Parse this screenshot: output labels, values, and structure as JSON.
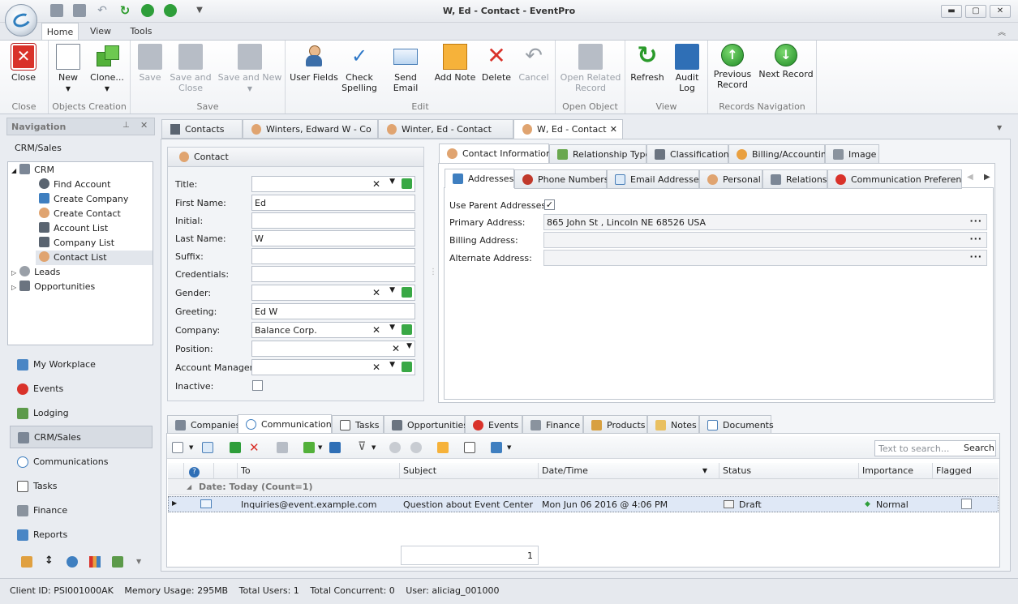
{
  "window": {
    "title": "W, Ed - Contact - EventPro",
    "minimize": "▬",
    "restore": "▢",
    "close": "✕"
  },
  "ribbon_tabs": [
    "Home",
    "View",
    "Tools"
  ],
  "ribbon": {
    "groups": [
      "Close",
      "Objects Creation",
      "Save",
      "Edit",
      "Open Object",
      "View",
      "Records Navigation"
    ],
    "buttons": {
      "close": "Close",
      "new": "New",
      "clone": "Clone...",
      "save": "Save",
      "save_close_1": "Save and",
      "save_close_2": "Close",
      "save_new": "Save and New",
      "user_fields": "User Fields",
      "check_1": "Check",
      "check_2": "Spelling",
      "send_email": "Send Email",
      "add_note": "Add Note",
      "delete": "Delete",
      "cancel": "Cancel",
      "open_related_1": "Open Related",
      "open_related_2": "Record",
      "refresh": "Refresh",
      "audit_1": "Audit",
      "audit_2": "Log",
      "prev_1": "Previous",
      "prev_2": "Record",
      "next": "Next Record"
    }
  },
  "navigation": {
    "title": "Navigation",
    "section": "CRM/Sales",
    "tree": {
      "crm": "CRM",
      "items": [
        "Find Account",
        "Create Company",
        "Create Contact",
        "Account List",
        "Company List",
        "Contact List"
      ],
      "leads": "Leads",
      "opportunities": "Opportunities"
    },
    "buttons": [
      "My Workplace",
      "Events",
      "Lodging",
      "CRM/Sales",
      "Communications",
      "Tasks",
      "Finance",
      "Reports"
    ]
  },
  "doc_tabs": [
    "Contacts",
    "Winters, Edward W - Co",
    "Winter, Ed - Contact",
    "W, Ed - Contact"
  ],
  "contact": {
    "header": "Contact",
    "fields": {
      "title": {
        "label": "Title:",
        "value": ""
      },
      "first_name": {
        "label": "First Name:",
        "value": "Ed"
      },
      "initial": {
        "label": "Initial:",
        "value": ""
      },
      "last_name": {
        "label": "Last Name:",
        "value": "W"
      },
      "suffix": {
        "label": "Suffix:",
        "value": ""
      },
      "credentials": {
        "label": "Credentials:",
        "value": ""
      },
      "gender": {
        "label": "Gender:",
        "value": ""
      },
      "greeting": {
        "label": "Greeting:",
        "value": "Ed W"
      },
      "company": {
        "label": "Company:",
        "value": "Balance Corp."
      },
      "position": {
        "label": "Position:",
        "value": ""
      },
      "account_manager": {
        "label": "Account Manager:",
        "value": ""
      },
      "inactive": {
        "label": "Inactive:"
      }
    }
  },
  "info_tabs": [
    "Contact Information",
    "Relationship Type",
    "Classification",
    "Billing/Accounting",
    "Image"
  ],
  "sub_tabs": [
    "Addresses",
    "Phone Numbers",
    "Email Addresses",
    "Personal",
    "Relations",
    "Communication Preferences"
  ],
  "addresses": {
    "use_parent": "Use Parent Addresses:",
    "primary_label": "Primary Address:",
    "primary_value": "865 John St , Lincoln NE 68526 USA",
    "billing_label": "Billing Address:",
    "billing_value": "",
    "alternate_label": "Alternate Address:",
    "alternate_value": ""
  },
  "bottom_tabs": [
    "Companies",
    "Communications",
    "Tasks",
    "Opportunities",
    "Events",
    "Finance",
    "Products",
    "Notes",
    "Documents"
  ],
  "grid": {
    "search_placeholder": "Text to search...",
    "search_button": "Search",
    "columns": [
      "To",
      "Subject",
      "Date/Time",
      "Status",
      "Importance",
      "Flagged"
    ],
    "group": "Date: Today (Count=1)",
    "rows": [
      {
        "to": "Inquiries@event.example.com",
        "subject": "Question about Event Center",
        "datetime": "Mon Jun 06 2016 @ 4:06 PM",
        "status": "Draft",
        "importance": "Normal"
      }
    ],
    "pager": "1"
  },
  "status": {
    "client": "Client ID: PSI001000AK",
    "memory": "Memory Usage: 295MB",
    "users": "Total Users: 1",
    "concurrent": "Total Concurrent: 0",
    "user": "User: aliciag_001000"
  },
  "colors": {
    "accent": "#2f7fbf",
    "green": "#2e9e3a",
    "red": "#d9322a"
  }
}
